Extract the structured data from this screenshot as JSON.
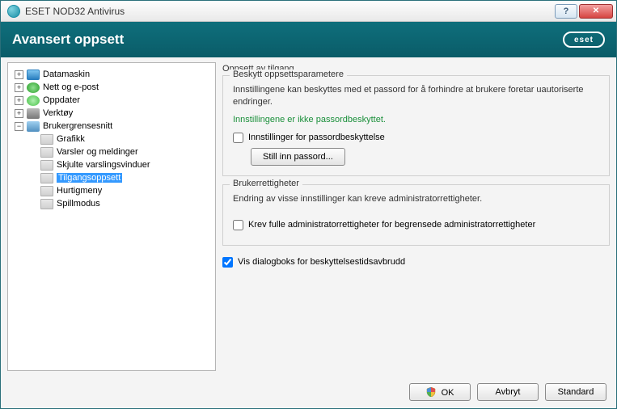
{
  "title": "ESET NOD32 Antivirus",
  "header": {
    "title": "Avansert oppsett",
    "logo": "eset"
  },
  "tree": {
    "datamaskin": "Datamaskin",
    "nett": "Nett og e-post",
    "oppdater": "Oppdater",
    "verktoy": "Verktøy",
    "brukergrensesnitt": "Brukergrensesnitt",
    "grafikk": "Grafikk",
    "varsler": "Varsler og meldinger",
    "skjulte": "Skjulte varslingsvinduer",
    "tilgang": "Tilgangsoppsett",
    "hurtig": "Hurtigmeny",
    "spill": "Spillmodus"
  },
  "content": {
    "section1_title": "Oppsett av tilgang",
    "group1_title": "Beskytt oppsettsparametere",
    "group1_desc": "Innstillingene kan beskyttes med et passord for å forhindre at brukere foretar uautoriserte endringer.",
    "group1_status": "Innstillingene er ikke passordbeskyttet.",
    "chk_password_protect": "Innstillinger for passordbeskyttelse",
    "btn_set_password": "Still inn passord...",
    "group2_title": "Brukerrettigheter",
    "group2_desc": "Endring av visse innstillinger kan kreve administratorrettigheter.",
    "chk_admin": "Krev fulle administratorrettigheter for begrensede administratorrettigheter",
    "chk_dialog": "Vis dialogboks for beskyttelsestidsavbrudd"
  },
  "buttons": {
    "ok": "OK",
    "cancel": "Avbryt",
    "default": "Standard"
  }
}
